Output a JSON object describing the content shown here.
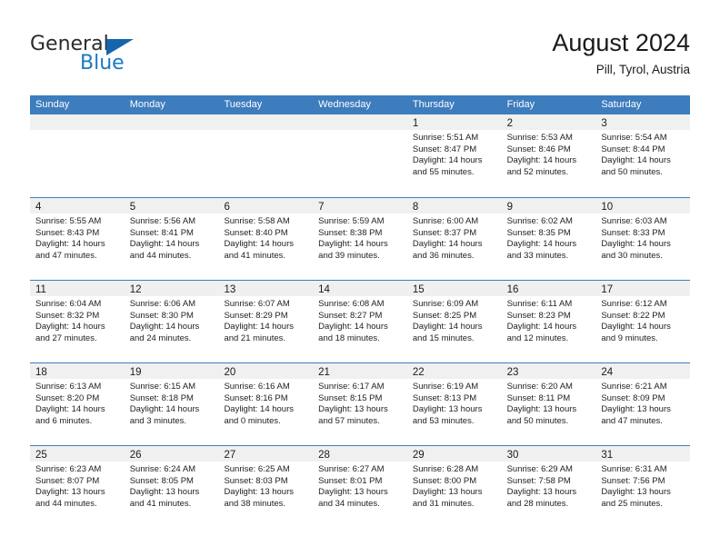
{
  "brand": {
    "name_part1": "General",
    "name_part2": "Blue",
    "logo_icon": "triangle-icon",
    "accent_color": "#1565ad",
    "blue_text_color": "#1b7ac2"
  },
  "header": {
    "title": "August 2024",
    "subtitle": "Pill, Tyrol, Austria"
  },
  "calendar": {
    "header_bg_color": "#3d7cbd",
    "daynum_band_color": "#f0f0f0",
    "weekdays": [
      "Sunday",
      "Monday",
      "Tuesday",
      "Wednesday",
      "Thursday",
      "Friday",
      "Saturday"
    ],
    "weeks": [
      [
        {
          "day": "",
          "sunrise": "",
          "sunset": "",
          "daylight": "",
          "empty": true
        },
        {
          "day": "",
          "sunrise": "",
          "sunset": "",
          "daylight": "",
          "empty": true
        },
        {
          "day": "",
          "sunrise": "",
          "sunset": "",
          "daylight": "",
          "empty": true
        },
        {
          "day": "",
          "sunrise": "",
          "sunset": "",
          "daylight": "",
          "empty": true
        },
        {
          "day": "1",
          "sunrise": "Sunrise: 5:51 AM",
          "sunset": "Sunset: 8:47 PM",
          "daylight": "Daylight: 14 hours and 55 minutes."
        },
        {
          "day": "2",
          "sunrise": "Sunrise: 5:53 AM",
          "sunset": "Sunset: 8:46 PM",
          "daylight": "Daylight: 14 hours and 52 minutes."
        },
        {
          "day": "3",
          "sunrise": "Sunrise: 5:54 AM",
          "sunset": "Sunset: 8:44 PM",
          "daylight": "Daylight: 14 hours and 50 minutes."
        }
      ],
      [
        {
          "day": "4",
          "sunrise": "Sunrise: 5:55 AM",
          "sunset": "Sunset: 8:43 PM",
          "daylight": "Daylight: 14 hours and 47 minutes."
        },
        {
          "day": "5",
          "sunrise": "Sunrise: 5:56 AM",
          "sunset": "Sunset: 8:41 PM",
          "daylight": "Daylight: 14 hours and 44 minutes."
        },
        {
          "day": "6",
          "sunrise": "Sunrise: 5:58 AM",
          "sunset": "Sunset: 8:40 PM",
          "daylight": "Daylight: 14 hours and 41 minutes."
        },
        {
          "day": "7",
          "sunrise": "Sunrise: 5:59 AM",
          "sunset": "Sunset: 8:38 PM",
          "daylight": "Daylight: 14 hours and 39 minutes."
        },
        {
          "day": "8",
          "sunrise": "Sunrise: 6:00 AM",
          "sunset": "Sunset: 8:37 PM",
          "daylight": "Daylight: 14 hours and 36 minutes."
        },
        {
          "day": "9",
          "sunrise": "Sunrise: 6:02 AM",
          "sunset": "Sunset: 8:35 PM",
          "daylight": "Daylight: 14 hours and 33 minutes."
        },
        {
          "day": "10",
          "sunrise": "Sunrise: 6:03 AM",
          "sunset": "Sunset: 8:33 PM",
          "daylight": "Daylight: 14 hours and 30 minutes."
        }
      ],
      [
        {
          "day": "11",
          "sunrise": "Sunrise: 6:04 AM",
          "sunset": "Sunset: 8:32 PM",
          "daylight": "Daylight: 14 hours and 27 minutes."
        },
        {
          "day": "12",
          "sunrise": "Sunrise: 6:06 AM",
          "sunset": "Sunset: 8:30 PM",
          "daylight": "Daylight: 14 hours and 24 minutes."
        },
        {
          "day": "13",
          "sunrise": "Sunrise: 6:07 AM",
          "sunset": "Sunset: 8:29 PM",
          "daylight": "Daylight: 14 hours and 21 minutes."
        },
        {
          "day": "14",
          "sunrise": "Sunrise: 6:08 AM",
          "sunset": "Sunset: 8:27 PM",
          "daylight": "Daylight: 14 hours and 18 minutes."
        },
        {
          "day": "15",
          "sunrise": "Sunrise: 6:09 AM",
          "sunset": "Sunset: 8:25 PM",
          "daylight": "Daylight: 14 hours and 15 minutes."
        },
        {
          "day": "16",
          "sunrise": "Sunrise: 6:11 AM",
          "sunset": "Sunset: 8:23 PM",
          "daylight": "Daylight: 14 hours and 12 minutes."
        },
        {
          "day": "17",
          "sunrise": "Sunrise: 6:12 AM",
          "sunset": "Sunset: 8:22 PM",
          "daylight": "Daylight: 14 hours and 9 minutes."
        }
      ],
      [
        {
          "day": "18",
          "sunrise": "Sunrise: 6:13 AM",
          "sunset": "Sunset: 8:20 PM",
          "daylight": "Daylight: 14 hours and 6 minutes."
        },
        {
          "day": "19",
          "sunrise": "Sunrise: 6:15 AM",
          "sunset": "Sunset: 8:18 PM",
          "daylight": "Daylight: 14 hours and 3 minutes."
        },
        {
          "day": "20",
          "sunrise": "Sunrise: 6:16 AM",
          "sunset": "Sunset: 8:16 PM",
          "daylight": "Daylight: 14 hours and 0 minutes."
        },
        {
          "day": "21",
          "sunrise": "Sunrise: 6:17 AM",
          "sunset": "Sunset: 8:15 PM",
          "daylight": "Daylight: 13 hours and 57 minutes."
        },
        {
          "day": "22",
          "sunrise": "Sunrise: 6:19 AM",
          "sunset": "Sunset: 8:13 PM",
          "daylight": "Daylight: 13 hours and 53 minutes."
        },
        {
          "day": "23",
          "sunrise": "Sunrise: 6:20 AM",
          "sunset": "Sunset: 8:11 PM",
          "daylight": "Daylight: 13 hours and 50 minutes."
        },
        {
          "day": "24",
          "sunrise": "Sunrise: 6:21 AM",
          "sunset": "Sunset: 8:09 PM",
          "daylight": "Daylight: 13 hours and 47 minutes."
        }
      ],
      [
        {
          "day": "25",
          "sunrise": "Sunrise: 6:23 AM",
          "sunset": "Sunset: 8:07 PM",
          "daylight": "Daylight: 13 hours and 44 minutes."
        },
        {
          "day": "26",
          "sunrise": "Sunrise: 6:24 AM",
          "sunset": "Sunset: 8:05 PM",
          "daylight": "Daylight: 13 hours and 41 minutes."
        },
        {
          "day": "27",
          "sunrise": "Sunrise: 6:25 AM",
          "sunset": "Sunset: 8:03 PM",
          "daylight": "Daylight: 13 hours and 38 minutes."
        },
        {
          "day": "28",
          "sunrise": "Sunrise: 6:27 AM",
          "sunset": "Sunset: 8:01 PM",
          "daylight": "Daylight: 13 hours and 34 minutes."
        },
        {
          "day": "29",
          "sunrise": "Sunrise: 6:28 AM",
          "sunset": "Sunset: 8:00 PM",
          "daylight": "Daylight: 13 hours and 31 minutes."
        },
        {
          "day": "30",
          "sunrise": "Sunrise: 6:29 AM",
          "sunset": "Sunset: 7:58 PM",
          "daylight": "Daylight: 13 hours and 28 minutes."
        },
        {
          "day": "31",
          "sunrise": "Sunrise: 6:31 AM",
          "sunset": "Sunset: 7:56 PM",
          "daylight": "Daylight: 13 hours and 25 minutes."
        }
      ]
    ]
  }
}
